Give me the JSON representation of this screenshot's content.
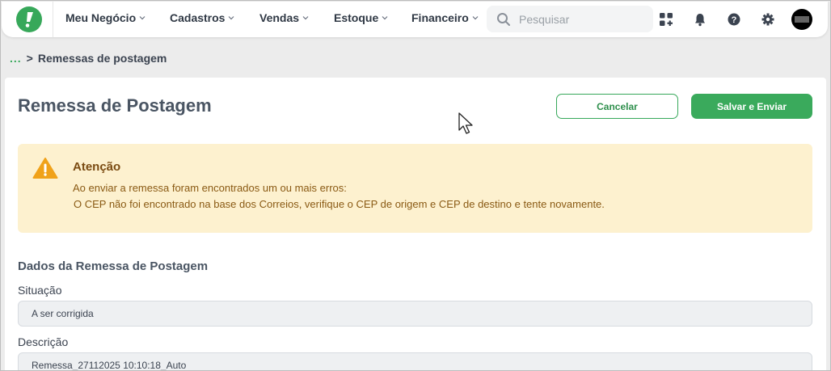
{
  "header": {
    "nav": [
      {
        "label": "Meu Negócio"
      },
      {
        "label": "Cadastros"
      },
      {
        "label": "Vendas"
      },
      {
        "label": "Estoque"
      },
      {
        "label": "Financeiro"
      }
    ],
    "search_placeholder": "Pesquisar",
    "icons": [
      "apps-icon",
      "bell-icon",
      "help-icon",
      "gear-icon",
      "avatar"
    ]
  },
  "breadcrumb": {
    "ellipsis": "...",
    "separator": ">",
    "current": "Remessas de postagem"
  },
  "page": {
    "title": "Remessa de Postagem",
    "cancel_label": "Cancelar",
    "save_label": "Salvar e Enviar"
  },
  "alert": {
    "title": "Atenção",
    "line1": "Ao enviar a remessa foram encontrados um ou mais erros:",
    "line2": "O CEP não foi encontrado na base dos Correios, verifique o CEP de origem e CEP de destino e tente novamente."
  },
  "form": {
    "section_title": "Dados da Remessa de Postagem",
    "situacao_label": "Situação",
    "situacao_value": "A ser corrigida",
    "descricao_label": "Descrição",
    "descricao_value": "Remessa_27112025 10:10:18_Auto"
  },
  "colors": {
    "brand_green": "#37a85a",
    "alert_bg": "#fdf1cf",
    "alert_icon": "#f0a21a"
  }
}
